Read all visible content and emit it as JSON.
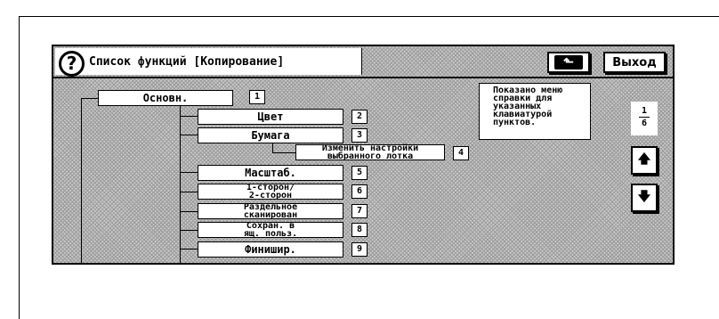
{
  "title": "Список функций [Копирование]",
  "buttons": {
    "back_icon": "return-arrow-icon",
    "exit_label": "Выход"
  },
  "help": {
    "icon": "question-mark-icon",
    "lines": [
      "Показано меню",
      "справки для",
      "указанных",
      "клавиатурой",
      "пунктов."
    ]
  },
  "tree": {
    "root": {
      "label": "Основн.",
      "num": "1"
    },
    "items": [
      {
        "label": "Цвет",
        "num": "2"
      },
      {
        "label": "Бумага",
        "num": "3"
      },
      {
        "label_lines": [
          "Изменить настройки",
          "выбранного лотка"
        ],
        "num": "4"
      },
      {
        "label": "Масштаб.",
        "num": "5"
      },
      {
        "label_lines": [
          "1-сторон/",
          "2-сторон"
        ],
        "num": "6"
      },
      {
        "label_lines": [
          "Раздельное",
          "сканирован"
        ],
        "num": "7"
      },
      {
        "label_lines": [
          "Сохран. в",
          "ящ. польз."
        ],
        "num": "8"
      },
      {
        "label": "Финишир.",
        "num": "9"
      }
    ]
  },
  "pagination": {
    "current": "1",
    "total": "6",
    "up_icon": "arrow-up-icon",
    "down_icon": "arrow-down-icon"
  }
}
